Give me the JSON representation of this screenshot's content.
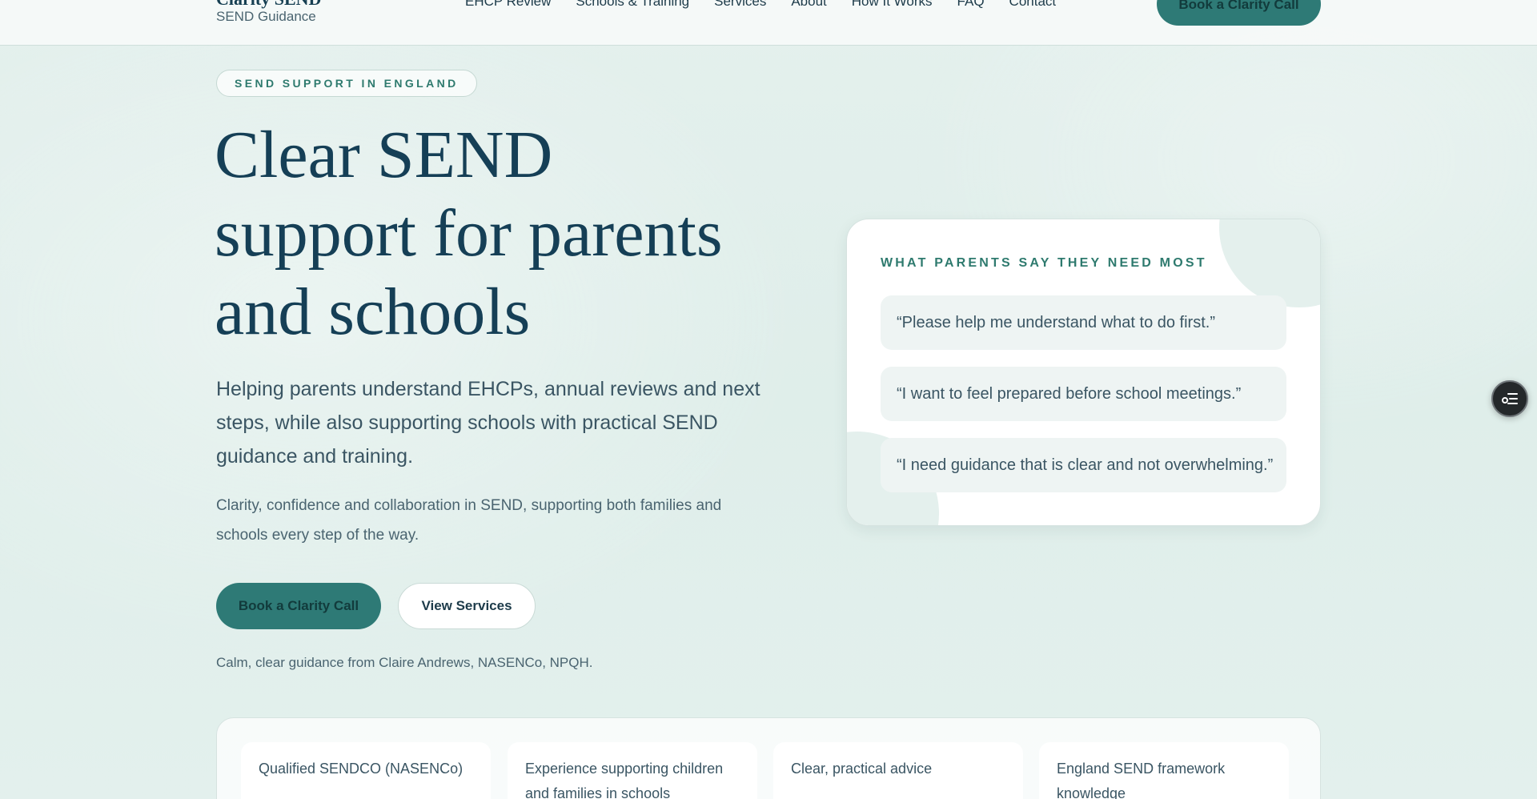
{
  "header": {
    "brand_name": "Clarity SEND",
    "brand_sub": "SEND Guidance",
    "nav": [
      "EHCP Review",
      "Schools & Training",
      "Services",
      "About",
      "How It Works",
      "FAQ",
      "Contact"
    ],
    "cta_label": "Book a Clarity Call"
  },
  "hero": {
    "eyebrow": "SEND SUPPORT IN ENGLAND",
    "title_lines": [
      "Clear SEND",
      "support for parents",
      "and schools"
    ],
    "lead": "Helping parents understand EHCPs, annual reviews and next steps, while also supporting schools with practical SEND guidance and training.",
    "sub": "Clarity, confidence and collaboration in SEND, supporting both families and schools every step of the way.",
    "primary_button": "Book a Clarity Call",
    "secondary_button": "View Services",
    "credit": "Calm, clear guidance from Claire Andrews, NASENCo, NPQH."
  },
  "quotes_card": {
    "heading": "WHAT PARENTS SAY THEY NEED MOST",
    "quotes": [
      "“Please help me understand what to do first.”",
      "“I want to feel prepared before school meetings.”",
      "“I need guidance that is clear and not overwhelming.”"
    ]
  },
  "credentials": [
    "Qualified SENDCO (NASENCo)",
    "Experience supporting children and families in schools",
    "Clear, practical advice",
    "England SEND framework knowledge"
  ],
  "floating_button_icon": "list-settings-icon",
  "colors": {
    "accent": "#2e7a76",
    "heading": "#153f56",
    "eyebrow": "#2e7a6e",
    "background": "#e1efeb"
  }
}
